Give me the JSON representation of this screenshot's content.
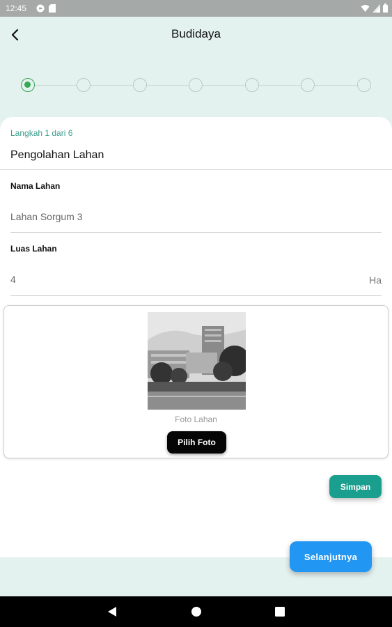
{
  "status_bar": {
    "time": "12:45",
    "left_icons": [
      "sync-icon",
      "sd-card-icon"
    ],
    "right_icons": [
      "wifi-icon",
      "signal-icon",
      "battery-icon"
    ]
  },
  "app_bar": {
    "title": "Budidaya",
    "back_icon": "back-arrow-icon"
  },
  "stepper": {
    "total_steps": 7,
    "active_step": 1,
    "active_color": "#34a853"
  },
  "form": {
    "step_caption": "Langkah 1 dari 6",
    "section_title": "Pengolahan Lahan",
    "nama_lahan": {
      "label": "Nama Lahan",
      "value": "Lahan Sorgum 3"
    },
    "luas_lahan": {
      "label": "Luas Lahan",
      "value": "4",
      "unit": "Ha"
    },
    "photo": {
      "caption": "Foto Lahan",
      "button_label": "Pilih Foto"
    },
    "save_label": "Simpan",
    "next_label": "Selanjutnya"
  },
  "colors": {
    "accent_teal": "#1a9e8d",
    "caption_teal": "#3c9d8e",
    "next_blue": "#2196f3",
    "background": "#e3f1ef"
  },
  "nav_bar": {
    "buttons": [
      "back-triangle-icon",
      "home-circle-icon",
      "recents-square-icon"
    ]
  }
}
